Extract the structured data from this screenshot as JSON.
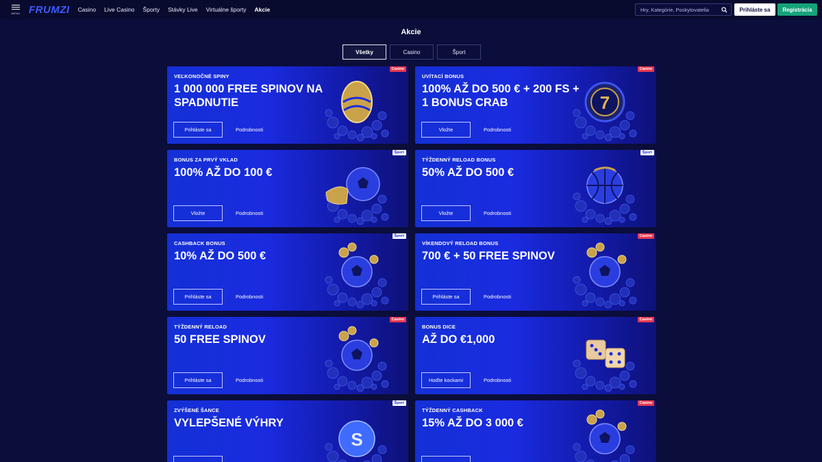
{
  "header": {
    "menu_label": "MENU",
    "logo_main": "FRUMZI",
    "nav": [
      "Casino",
      "Live Casino",
      "Športy",
      "Stávky Live",
      "Virtuálne športy",
      "Akcie"
    ],
    "active_nav": "Akcie",
    "search_placeholder": "Hry, Kategórie, Poskytovatelia",
    "login_label": "Prihláste sa",
    "register_label": "Registrácia"
  },
  "page": {
    "title": "Akcie",
    "tabs": [
      "Všetky",
      "Casino",
      "Šport"
    ],
    "active_tab": "Všetky"
  },
  "colors": {
    "background": "#0b0d3a",
    "card_blue": "#1a2be0",
    "casino_badge": "#e8384f",
    "register_green": "#15a37a"
  },
  "promos": [
    {
      "badge": "Casino",
      "subtitle": "VEĽKONOČNÉ SPINY",
      "headline": "1 000 000 FREE SPINOV NA SPADNUTIE",
      "cta": "Prihláste sa",
      "details": "Podrobnosti",
      "art": "easter-egg-icon"
    },
    {
      "badge": "Casino",
      "subtitle": "UVÍTACÍ BONUS",
      "headline": "100% AŽ DO 500 € + 200 FS + 1 BONUS CRAB",
      "cta": "Vložte",
      "details": "Podrobnosti",
      "art": "slot-seven-icon"
    },
    {
      "badge": "Šport",
      "subtitle": "BONUS ZA PRVÝ VKLAD",
      "headline": "100% AŽ DO 100 €",
      "cta": "Vložte",
      "details": "Podrobnosti",
      "art": "football-boot-icon"
    },
    {
      "badge": "Šport",
      "subtitle": "TÝŽDENNÝ RELOAD BONUS",
      "headline": "50% AŽ DO 500 €",
      "cta": "Vložte",
      "details": "Podrobnosti",
      "art": "basketball-icon"
    },
    {
      "badge": "Šport",
      "subtitle": "CASHBACK BONUS",
      "headline": "10% AŽ DO 500 €",
      "cta": "Prihláste sa",
      "details": "Podrobnosti",
      "art": "football-coins-icon"
    },
    {
      "badge": "Casino",
      "subtitle": "VÍKENDOVÝ RELOAD BONUS",
      "headline": "700 € + 50 FREE SPINOV",
      "cta": "Prihláste sa",
      "details": "Podrobnosti",
      "art": "football-coins-icon"
    },
    {
      "badge": "Casino",
      "subtitle": "TÝŽDENNÝ RELOAD",
      "headline": "50 FREE SPINOV",
      "cta": "Prihláste sa",
      "details": "Podrobnosti",
      "art": "football-coins-icon"
    },
    {
      "badge": "Casino",
      "subtitle": "BONUS DICE",
      "headline": "AŽ DO €1,000",
      "cta": "Hoďte kockami",
      "details": "Podrobnosti",
      "art": "dice-icon"
    },
    {
      "badge": "Šport",
      "subtitle": "ZVÝŠENÉ ŠANCE",
      "headline": "VYLEPŠENÉ VÝHRY",
      "cta": "",
      "details": "",
      "art": "dollar-ball-icon"
    },
    {
      "badge": "Casino",
      "subtitle": "TÝŽDENNÝ CASHBACK",
      "headline": "15% AŽ DO 3 000 €",
      "cta": "",
      "details": "",
      "art": "football-coins-icon"
    }
  ]
}
